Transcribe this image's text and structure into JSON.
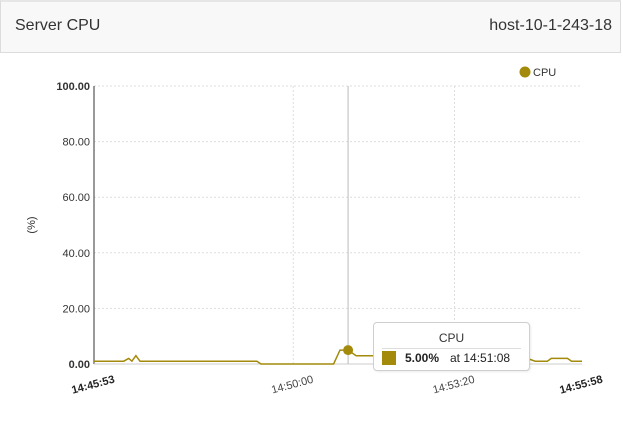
{
  "panel": {
    "title": "Server CPU",
    "host": "host-10-1-243-18"
  },
  "colors": {
    "series": "#a38a0a",
    "grid": "#dddddd",
    "crosshair": "#bbbbbb"
  },
  "chart_data": {
    "type": "line",
    "title": "",
    "ylabel": "(%)",
    "ylim": [
      0,
      100
    ],
    "yticks": [
      "0.00",
      "20.00",
      "40.00",
      "60.00",
      "80.00",
      "100.00"
    ],
    "xticks": [
      "14:45:53",
      "14:50:00",
      "14:53:20",
      "14:55:58"
    ],
    "x_range": [
      "14:45:53",
      "14:55:58"
    ],
    "grid": true,
    "legend": {
      "position": "top-right",
      "entries": [
        "CPU"
      ]
    },
    "series": [
      {
        "name": "CPU",
        "points": [
          [
            "14:45:53",
            1.0
          ],
          [
            "14:46:30",
            1.0
          ],
          [
            "14:46:36",
            2.0
          ],
          [
            "14:46:40",
            1.0
          ],
          [
            "14:46:45",
            3.0
          ],
          [
            "14:46:50",
            1.0
          ],
          [
            "14:49:15",
            1.0
          ],
          [
            "14:49:20",
            0.0
          ],
          [
            "14:50:30",
            0.0
          ],
          [
            "14:50:50",
            0.0
          ],
          [
            "14:50:58",
            5.0
          ],
          [
            "14:51:08",
            5.0
          ],
          [
            "14:51:18",
            3.0
          ],
          [
            "14:51:40",
            3.0
          ],
          [
            "14:51:48",
            2.0
          ],
          [
            "14:54:50",
            2.0
          ],
          [
            "14:55:00",
            1.0
          ],
          [
            "14:55:15",
            1.0
          ],
          [
            "14:55:20",
            2.0
          ],
          [
            "14:55:40",
            2.0
          ],
          [
            "14:55:45",
            1.0
          ],
          [
            "14:55:58",
            1.0
          ]
        ]
      }
    ],
    "tooltip": {
      "series": "CPU",
      "value": "5.00%",
      "at_label": "at 14:51:08",
      "time": "14:51:08",
      "y": 5.0
    }
  }
}
